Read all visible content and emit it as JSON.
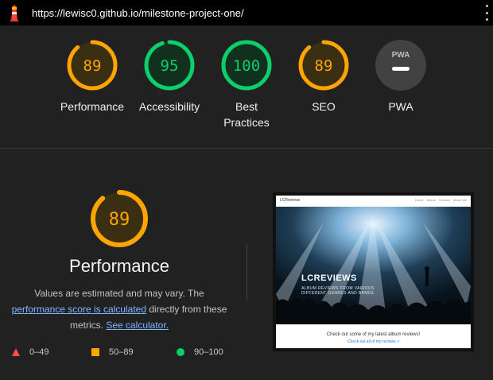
{
  "topbar": {
    "url": "https://lewisc0.github.io/milestone-project-one/"
  },
  "gauges": [
    {
      "score": 89,
      "score_label": "89",
      "label_lines": [
        "Performance"
      ],
      "color": "#ffa400",
      "bg": "#3a2e13"
    },
    {
      "score": 95,
      "score_label": "95",
      "label_lines": [
        "Accessibility"
      ],
      "color": "#0cce6b",
      "bg": "#11301d"
    },
    {
      "score": 100,
      "score_label": "100",
      "label_lines": [
        "Best",
        "Practices"
      ],
      "color": "#0cce6b",
      "bg": "#11301d"
    },
    {
      "score": 89,
      "score_label": "89",
      "label_lines": [
        "SEO"
      ],
      "color": "#ffa400",
      "bg": "#3a2e13"
    },
    {
      "score": null,
      "score_label": "PWA",
      "label_lines": [
        "PWA"
      ],
      "color": "#9e9e9e",
      "bg": "#424242"
    }
  ],
  "performance": {
    "score": 89,
    "score_label": "89",
    "title": "Performance",
    "desc_part1": "Values are estimated and may vary. The",
    "desc_link1": "performance score is calculated",
    "desc_part2": " directly from these metrics. ",
    "desc_link2": "See calculator."
  },
  "legend": [
    {
      "shape": "triangle",
      "label": "0–49",
      "color": "#ff4e42"
    },
    {
      "shape": "square",
      "label": "50–89",
      "color": "#ffa400"
    },
    {
      "shape": "circle",
      "label": "90–100",
      "color": "#0cce6b"
    }
  ],
  "screenshot": {
    "brand": "LCReviews",
    "nav_links": [
      "Home",
      "Album",
      "Contact",
      "About Me"
    ],
    "hero_title": "LCREVIEWS",
    "hero_subtitle": "ALBUM REVIEWS FROM VARIOUS DIFFERENT GENRES AND BANDS.",
    "footer_text": "Check out some of my latest album reviews!",
    "footer_link": "Check out all of my reviews >"
  }
}
